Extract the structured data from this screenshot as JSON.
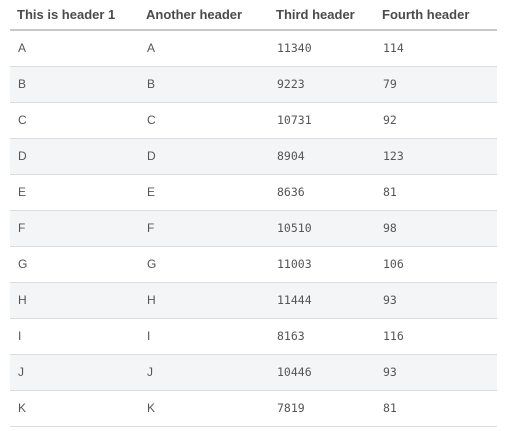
{
  "table": {
    "headers": [
      "This is header 1",
      "Another header",
      "Third header",
      "Fourth header"
    ],
    "rows": [
      [
        "A",
        "A",
        "11340",
        "114"
      ],
      [
        "B",
        "B",
        "9223",
        "79"
      ],
      [
        "C",
        "C",
        "10731",
        "92"
      ],
      [
        "D",
        "D",
        "8904",
        "123"
      ],
      [
        "E",
        "E",
        "8636",
        "81"
      ],
      [
        "F",
        "F",
        "10510",
        "98"
      ],
      [
        "G",
        "G",
        "11003",
        "106"
      ],
      [
        "H",
        "H",
        "11444",
        "93"
      ],
      [
        "I",
        "I",
        "8163",
        "116"
      ],
      [
        "J",
        "J",
        "10446",
        "93"
      ],
      [
        "K",
        "K",
        "7819",
        "81"
      ]
    ]
  },
  "colors": {
    "stripe": "#f4f5f7",
    "header_border": "#c8c8c8",
    "row_border": "#dcdcdc",
    "text": "#555555"
  }
}
